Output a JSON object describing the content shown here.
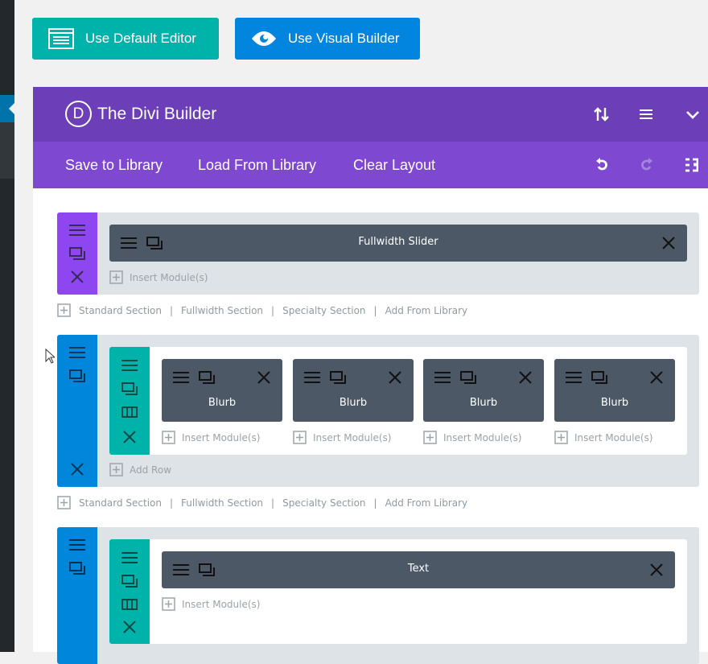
{
  "top_buttons": {
    "default_editor": "Use Default Editor",
    "visual_builder": "Use Visual Builder"
  },
  "header": {
    "logo_letter": "D",
    "title": "The Divi Builder"
  },
  "toolbar": {
    "save": "Save to Library",
    "load": "Load From Library",
    "clear": "Clear Layout"
  },
  "section_links": {
    "standard": "Standard Section",
    "fullwidth": "Fullwidth Section",
    "specialty": "Specialty Section",
    "library": "Add From Library",
    "sep": "|"
  },
  "sections": [
    {
      "module": "Fullwidth Slider",
      "insert": "Insert Module(s)"
    },
    {
      "modules": [
        "Blurb",
        "Blurb",
        "Blurb",
        "Blurb"
      ],
      "insert": "Insert Module(s)",
      "add_row": "Add Row"
    },
    {
      "module": "Text",
      "insert": "Insert Module(s)"
    }
  ],
  "colors": {
    "teal": "#00b3aa",
    "blue": "#0087dc",
    "purple_dark": "#6c3eb8",
    "purple": "#7e49d0",
    "section_purple": "#8e46f0",
    "module": "#4c5866"
  }
}
